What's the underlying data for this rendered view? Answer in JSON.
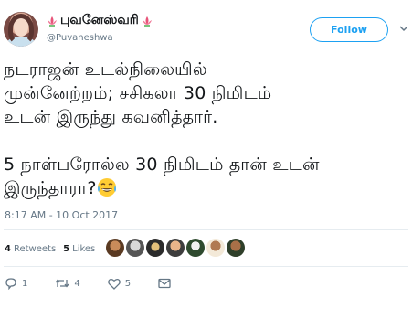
{
  "user": {
    "display_name": "புவனேஸ்வரி",
    "handle": "@Puvaneshwa",
    "avatar_icon": "profile-photo"
  },
  "follow_button": {
    "label": "Follow"
  },
  "tweet": {
    "line1": "நடராஜன் உடல்நிலையில்",
    "line2": "முன்னேற்றம்; சசிகலா 30 நிமிடம்",
    "line3": "உடன் இருந்து கவனித்தார்.",
    "line4": "5 நாள்பரோல்ல 30 நிமிடம் தான் உடன்",
    "line5": "இருந்தாரா?",
    "emoji": "face-with-tears-of-joy",
    "timestamp": "8:17 AM - 10 Oct 2017"
  },
  "stats": {
    "retweets_count": "4",
    "retweets_label": "Retweets",
    "likes_count": "5",
    "likes_label": "Likes",
    "liker_avatars_count": 7
  },
  "actions": {
    "reply_count": "1",
    "retweet_count": "4",
    "like_count": "5"
  },
  "colors": {
    "accent": "#1da1f2",
    "secondary_text": "#657786",
    "primary_text": "#14171a",
    "divider": "#e6ecf0",
    "lotus": "#e8557a"
  }
}
